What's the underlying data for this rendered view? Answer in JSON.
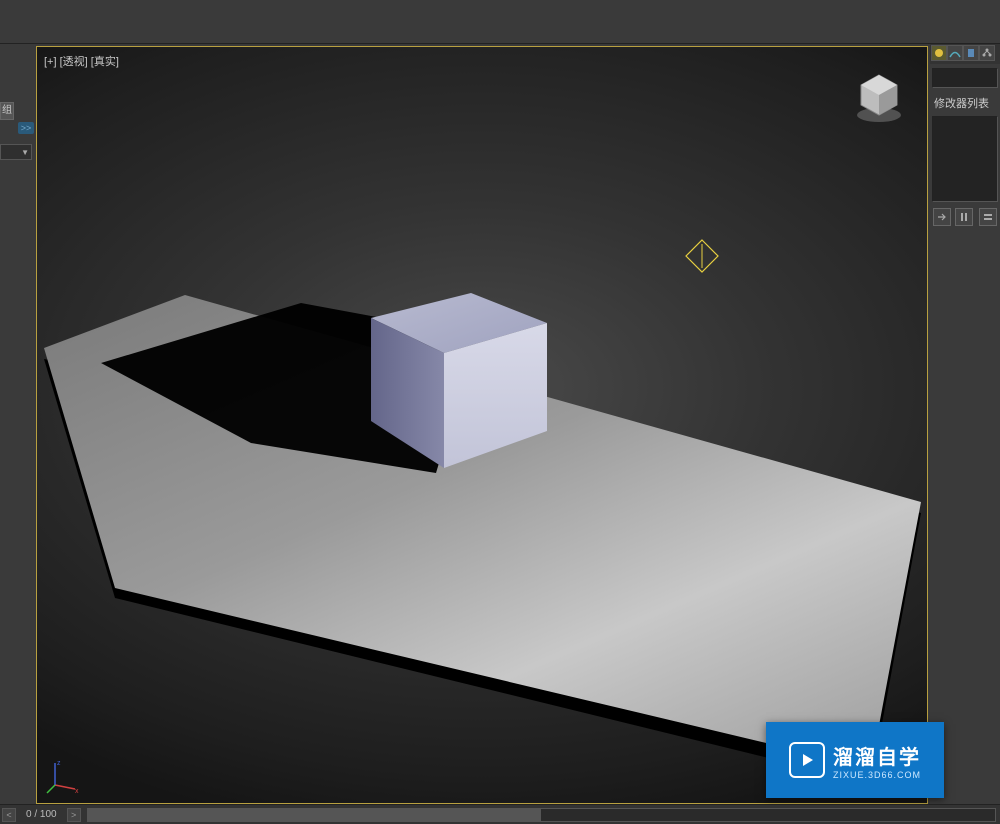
{
  "viewport": {
    "label": "[+] [透视] [真实]"
  },
  "left": {
    "tab": "组",
    "expand": ">>"
  },
  "right": {
    "modifier_label": "修改器列表",
    "btn_pin": "⟶",
    "btn_config": "𝍤"
  },
  "timeline": {
    "frame_label": "0 / 100",
    "prev": "<",
    "next": ">"
  },
  "watermark": {
    "title": "溜溜自学",
    "url": "ZIXUE.3D66.COM"
  },
  "icons": {
    "sphere": "sphere",
    "arc": "arc",
    "cylinder": "cylinder",
    "hierarchy": "hierarchy"
  }
}
